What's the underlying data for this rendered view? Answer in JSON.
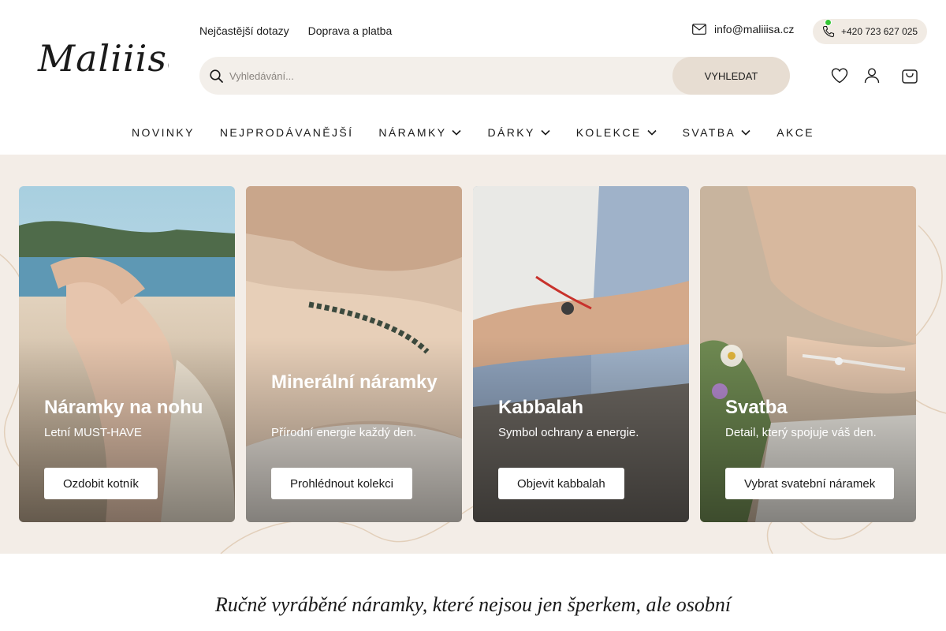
{
  "brand": {
    "logo_text": "Maliiisa"
  },
  "toplinks": [
    {
      "label": "Nejčastější dotazy"
    },
    {
      "label": "Doprava a platba"
    }
  ],
  "contact": {
    "email": "info@maliiisa.cz",
    "phone": "+420 723 627 025",
    "status_color": "#35c635"
  },
  "search": {
    "placeholder": "Vyhledávání...",
    "value": "",
    "button": "VYHLEDAT",
    "icon": "search-icon"
  },
  "header_icons": [
    "heart-icon",
    "user-icon",
    "cart-icon"
  ],
  "nav": [
    {
      "label": "NOVINKY",
      "dropdown": false
    },
    {
      "label": "NEJPRODÁVANĚJŠÍ",
      "dropdown": false
    },
    {
      "label": "NÁRAMKY",
      "dropdown": true
    },
    {
      "label": "DÁRKY",
      "dropdown": true
    },
    {
      "label": "KOLEKCE",
      "dropdown": true
    },
    {
      "label": "SVATBA",
      "dropdown": true
    },
    {
      "label": "AKCE",
      "dropdown": false
    }
  ],
  "cards": [
    {
      "title": "Náramky na nohu",
      "subtitle": "Letní MUST-HAVE",
      "button": "Ozdobit kotník"
    },
    {
      "title": "Minerální náramky",
      "subtitle": "Přírodní energie každý den.",
      "button": "Prohlédnout kolekci"
    },
    {
      "title": "Kabbalah",
      "subtitle": "Symbol ochrany a energie.",
      "button": "Objevit kabbalah"
    },
    {
      "title": "Svatba",
      "subtitle": "Detail, který spojuje váš den.",
      "button": "Vybrat svatební náramek"
    }
  ],
  "colors": {
    "hero_bg": "#f3ede7",
    "search_bg": "#f3efea",
    "search_button_bg": "#e7ddd2",
    "phone_pill_bg": "#f1ebe4"
  },
  "tagline": "Ručně vyráběné náramky, které nejsou jen šperkem, ale osobní"
}
